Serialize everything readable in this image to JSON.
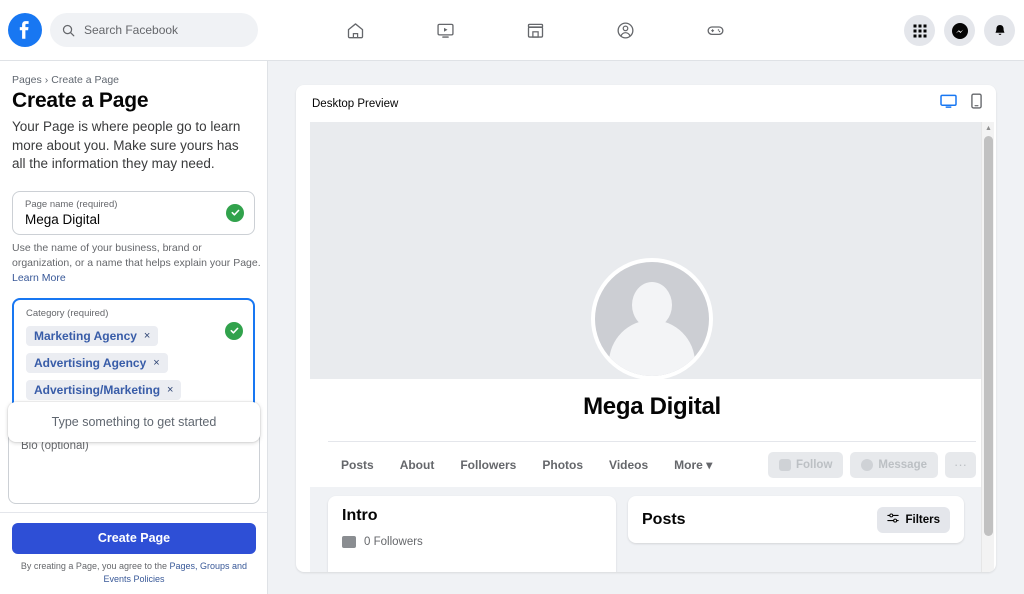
{
  "topbar": {
    "logo": "facebook-logo",
    "search_placeholder": "Search Facebook",
    "nav_icons": [
      "home-icon",
      "watch-icon",
      "marketplace-icon",
      "groups-icon",
      "gaming-icon"
    ],
    "right_icons": [
      "grid-menu-icon",
      "messenger-icon",
      "notifications-icon"
    ]
  },
  "sidebar": {
    "breadcrumb_root": "Pages",
    "breadcrumb_sep": "›",
    "breadcrumb_current": "Create a Page",
    "title": "Create a Page",
    "description": "Your Page is where people go to learn more about you. Make sure yours has all the information they may need.",
    "page_name": {
      "label": "Page name (required)",
      "value": "Mega Digital",
      "valid": true,
      "helper_text": "Use the name of your business, brand or organization, or a name that helps explain your Page.",
      "helper_link": "Learn More"
    },
    "category": {
      "label": "Category (required)",
      "valid": true,
      "tags": [
        {
          "label": "Marketing Agency",
          "remove": "×"
        },
        {
          "label": "Advertising Agency",
          "remove": "×"
        },
        {
          "label": "Advertising/Marketing",
          "remove": "×"
        }
      ]
    },
    "dropdown_hint": "Type something to get started",
    "bio": {
      "label": "Bio (optional)",
      "value": ""
    },
    "create_button": "Create Page",
    "terms_prefix": "By creating a Page, you agree to the ",
    "terms_link": "Pages, Groups and Events Policies"
  },
  "preview": {
    "header_title": "Desktop Preview",
    "desktop_icon": "desktop-icon",
    "mobile_icon": "mobile-icon",
    "page_name": "Mega Digital",
    "avatar": "default-avatar-icon",
    "tabs": [
      {
        "label": "Posts"
      },
      {
        "label": "About"
      },
      {
        "label": "Followers"
      },
      {
        "label": "Photos"
      },
      {
        "label": "Videos"
      },
      {
        "label": "More",
        "caret": "▾"
      }
    ],
    "actions": {
      "follow": "Follow",
      "message": "Message",
      "more": "···"
    },
    "intro_card": {
      "heading": "Intro",
      "followers": "0 Followers"
    },
    "posts_card": {
      "heading": "Posts",
      "filters": "Filters"
    }
  },
  "colors": {
    "fb_blue": "#1877f2",
    "create_btn": "#2e4fd6",
    "valid_green": "#31a24c",
    "tag_text": "#385ca8",
    "link_blue": "#385898"
  }
}
